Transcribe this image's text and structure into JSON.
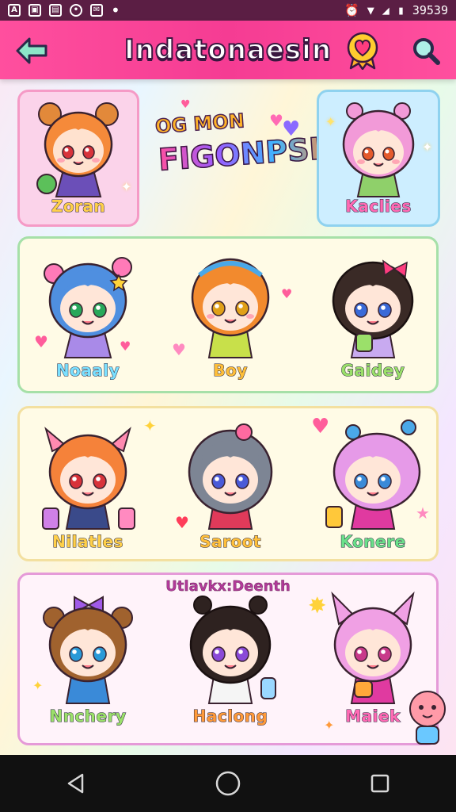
{
  "status_bar": {
    "time": "39539",
    "icons": [
      "app-a-icon",
      "app-image-icon",
      "app-file-icon",
      "location-icon",
      "message-icon",
      "dot-icon"
    ],
    "right_icons": [
      "alarm-icon",
      "wifi-icon",
      "signal-icon",
      "battery-icon"
    ]
  },
  "app_bar": {
    "title": "Indatonaesin",
    "back_icon": "back-arrow-icon",
    "favorite_icon": "heart-badge-icon",
    "search_icon": "search-icon"
  },
  "banner": {
    "line1": "OG MON",
    "line2": "FIGONPSI!"
  },
  "rows": [
    {
      "title": "",
      "characters": [
        {
          "name": "Zoran",
          "hair": "#f58a3a",
          "eyes": "#d8333a",
          "name_color": "#ffd04a"
        },
        {
          "name": "Kaclies",
          "hair": "#f29ad8",
          "eyes": "#e45a2c",
          "name_color": "#ff6ab4"
        }
      ]
    },
    {
      "title": "",
      "characters": [
        {
          "name": "Noaaly",
          "hair": "#4f8fe0",
          "eyes": "#28a85a",
          "name_color": "#7be0ff"
        },
        {
          "name": "Boy",
          "hair": "#f28a2e",
          "eyes": "#e0a018",
          "name_color": "#ffbf3a"
        },
        {
          "name": "Gaidey",
          "hair": "#3a2a26",
          "eyes": "#3a6ad8",
          "name_color": "#9be06a"
        }
      ]
    },
    {
      "title": "",
      "characters": [
        {
          "name": "Nilatles",
          "hair": "#f5823a",
          "eyes": "#d8333a",
          "name_color": "#ffd04a"
        },
        {
          "name": "Saroot",
          "hair": "#7d8594",
          "eyes": "#4a5ad8",
          "name_color": "#ffbf3a"
        },
        {
          "name": "Konere",
          "hair": "#e69ae8",
          "eyes": "#3a8ad8",
          "name_color": "#6ae08a"
        }
      ]
    },
    {
      "title": "Utlavkx:Deenth",
      "characters": [
        {
          "name": "Nnchery",
          "hair": "#a0622e",
          "eyes": "#2a9ad8",
          "name_color": "#9be06a"
        },
        {
          "name": "Haclong",
          "hair": "#2e2220",
          "eyes": "#8a4ad8",
          "name_color": "#ff9a3a"
        },
        {
          "name": "Maiek",
          "hair": "#f0a0e4",
          "eyes": "#c83a8a",
          "name_color": "#ff6ab4"
        }
      ]
    }
  ],
  "nav_bar": {
    "back": "nav-back-icon",
    "home": "nav-home-icon",
    "recents": "nav-recents-icon"
  },
  "colors": {
    "app_bar": "#f53c93",
    "status_bar": "#5b1e44",
    "card_pink": "#fbd3ea",
    "card_blue": "#cdeeff",
    "card_cream": "#fffbe6"
  }
}
